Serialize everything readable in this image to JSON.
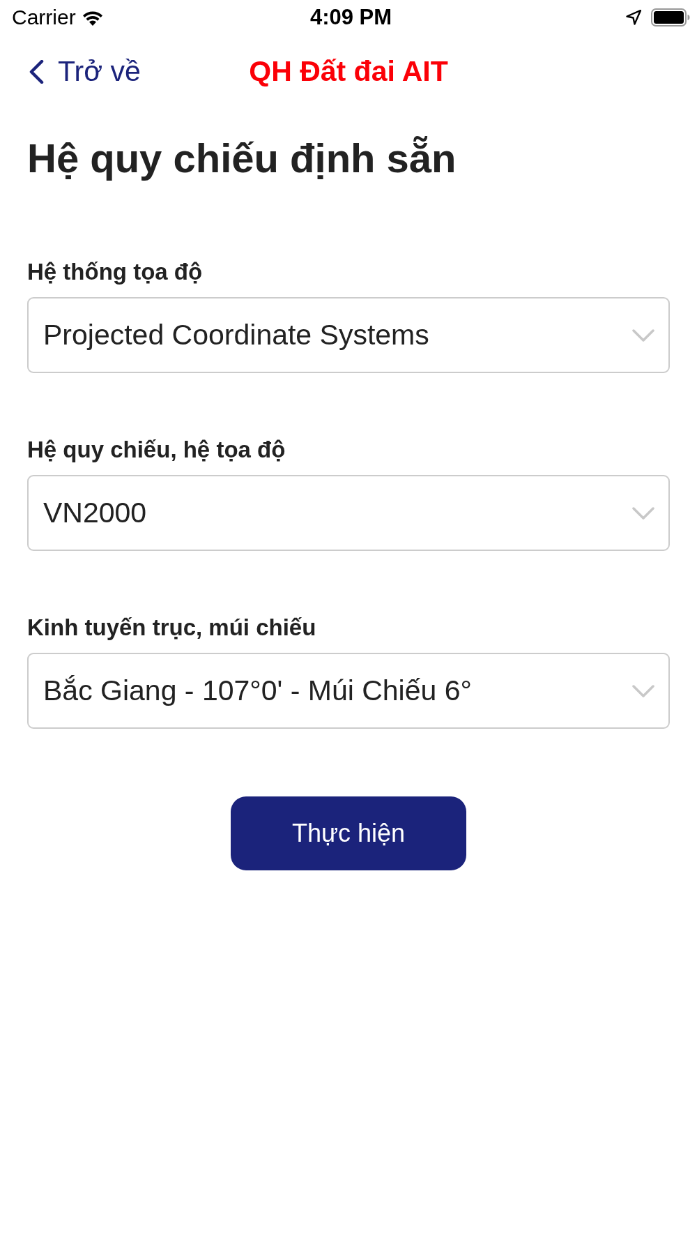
{
  "status_bar": {
    "carrier": "Carrier",
    "time": "4:09 PM"
  },
  "nav": {
    "back_label": "Trở về",
    "title": "QH Đất đai AIT"
  },
  "heading": "Hệ quy chiếu định sẵn",
  "fields": [
    {
      "label": "Hệ thống tọa độ",
      "value": "Projected Coordinate Systems"
    },
    {
      "label": "Hệ quy chiếu, hệ tọa độ",
      "value": "VN2000"
    },
    {
      "label": "Kinh tuyến trục, múi chiếu",
      "value": "Bắc Giang - 107°0' - Múi Chiếu 6°"
    }
  ],
  "submit_button": "Thực hiện"
}
